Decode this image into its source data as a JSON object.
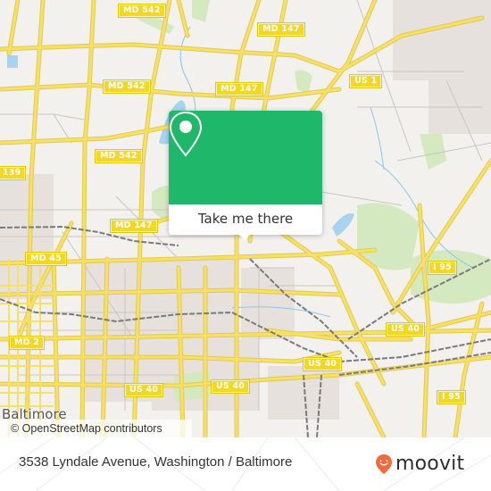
{
  "map": {
    "city_label": "Baltimore",
    "attribution": "© OpenStreetMap contributors",
    "route_shields": [
      {
        "label": "MD 542"
      },
      {
        "label": "MD 147"
      },
      {
        "label": "MD 542"
      },
      {
        "label": "MD 147"
      },
      {
        "label": "US 1"
      },
      {
        "label": "MD 542"
      },
      {
        "label": "139"
      },
      {
        "label": "MD 147"
      },
      {
        "label": "MD 45"
      },
      {
        "label": "I 95"
      },
      {
        "label": "US 40"
      },
      {
        "label": "MD 2"
      },
      {
        "label": "US 40"
      },
      {
        "label": "US 40"
      },
      {
        "label": "US 40"
      },
      {
        "label": "I 95"
      }
    ],
    "colors": {
      "background": "#f2f1ed",
      "major_road": "#f7e067",
      "minor_road": "#bdbab5",
      "park": "#d4e9c0",
      "water": "#a8d3ef",
      "railway": "#7a7a7a"
    }
  },
  "popup": {
    "icon": "location-pin-icon",
    "button_label": "Take me there",
    "accent_color": "#1fb86b"
  },
  "footer": {
    "address": "3538 Lyndale Avenue, Washington / Baltimore",
    "brand": "moovit",
    "brand_icon": "moovit-smiley-pin-icon",
    "brand_color": "#f26a3d"
  }
}
